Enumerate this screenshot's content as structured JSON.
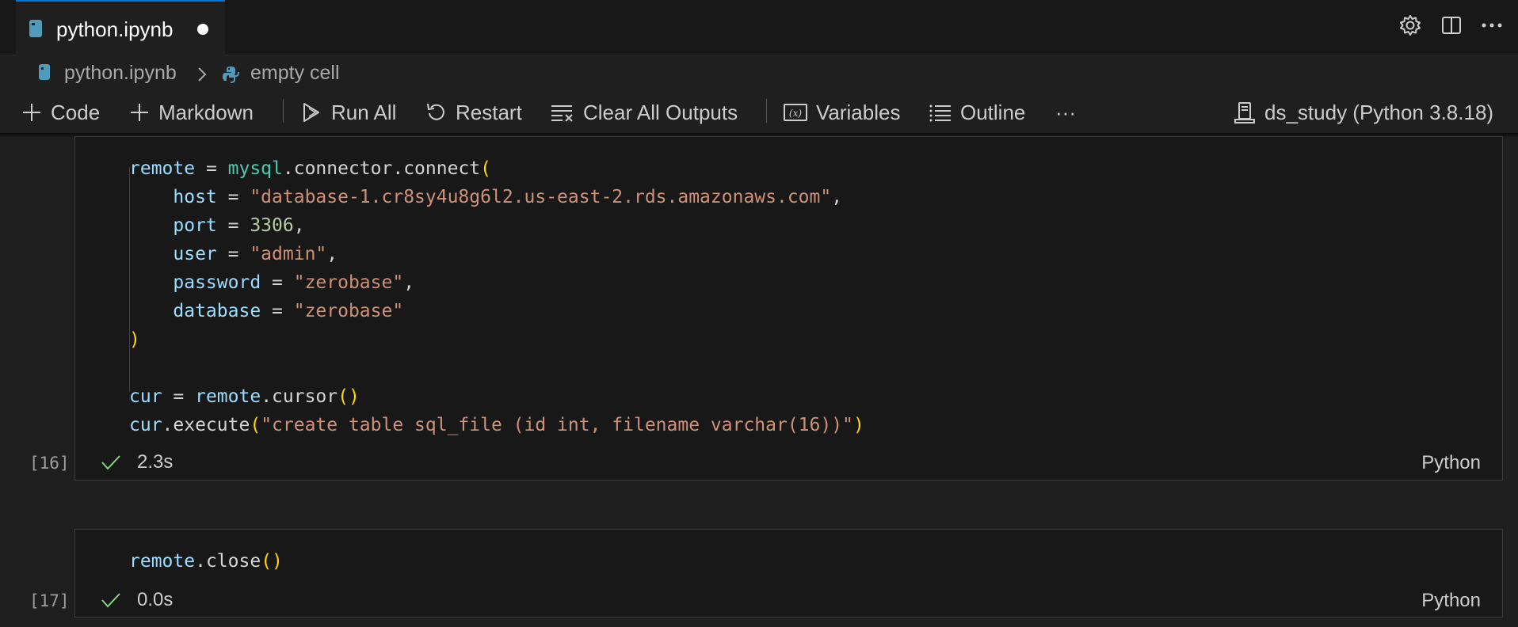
{
  "tab": {
    "title": "python.ipynb"
  },
  "breadcrumb": {
    "file": "python.ipynb",
    "cell": "empty cell"
  },
  "toolbar": {
    "code": "Code",
    "markdown": "Markdown",
    "run_all": "Run All",
    "restart": "Restart",
    "clear_outputs": "Clear All Outputs",
    "variables": "Variables",
    "outline": "Outline",
    "more": "···",
    "kernel": "ds_study (Python 3.8.18)"
  },
  "cells": [
    {
      "exec_count": "[16]",
      "time": "2.3s",
      "language": "Python",
      "lines": [
        [
          [
            "remote",
            "var"
          ],
          [
            " = ",
            "op"
          ],
          [
            "mysql",
            "mod"
          ],
          [
            ".connector.connect",
            "op"
          ],
          [
            "(",
            "par"
          ]
        ],
        [
          [
            "    host",
            "var"
          ],
          [
            " = ",
            "op"
          ],
          [
            "\"database-1.cr8sy4u8g6l2.us-east-2.rds.amazonaws.com\"",
            "str"
          ],
          [
            ",",
            "op"
          ]
        ],
        [
          [
            "    port",
            "var"
          ],
          [
            " = ",
            "op"
          ],
          [
            "3306",
            "num"
          ],
          [
            ",",
            "op"
          ]
        ],
        [
          [
            "    user",
            "var"
          ],
          [
            " = ",
            "op"
          ],
          [
            "\"admin\"",
            "str"
          ],
          [
            ",",
            "op"
          ]
        ],
        [
          [
            "    password",
            "var"
          ],
          [
            " = ",
            "op"
          ],
          [
            "\"zerobase\"",
            "str"
          ],
          [
            ",",
            "op"
          ]
        ],
        [
          [
            "    database",
            "var"
          ],
          [
            " = ",
            "op"
          ],
          [
            "\"zerobase\"",
            "str"
          ]
        ],
        [
          [
            ")",
            "par"
          ]
        ],
        [],
        [
          [
            "cur",
            "var"
          ],
          [
            " = ",
            "op"
          ],
          [
            "remote",
            "var"
          ],
          [
            ".cursor",
            "op"
          ],
          [
            "()",
            "par"
          ]
        ],
        [
          [
            "cur",
            "var"
          ],
          [
            ".execute",
            "op"
          ],
          [
            "(",
            "par"
          ],
          [
            "\"create table sql_file (id int, filename varchar(16))\"",
            "str"
          ],
          [
            ")",
            "par"
          ]
        ]
      ]
    },
    {
      "exec_count": "[17]",
      "time": "0.0s",
      "language": "Python",
      "lines": [
        [
          [
            "remote",
            "var"
          ],
          [
            ".close",
            "op"
          ],
          [
            "()",
            "par"
          ]
        ]
      ]
    }
  ],
  "colors": {
    "accent": "#0078d4",
    "success": "#89d185",
    "string": "#ce9178",
    "variable": "#9cdcfe",
    "bracket": "#ffd700"
  }
}
